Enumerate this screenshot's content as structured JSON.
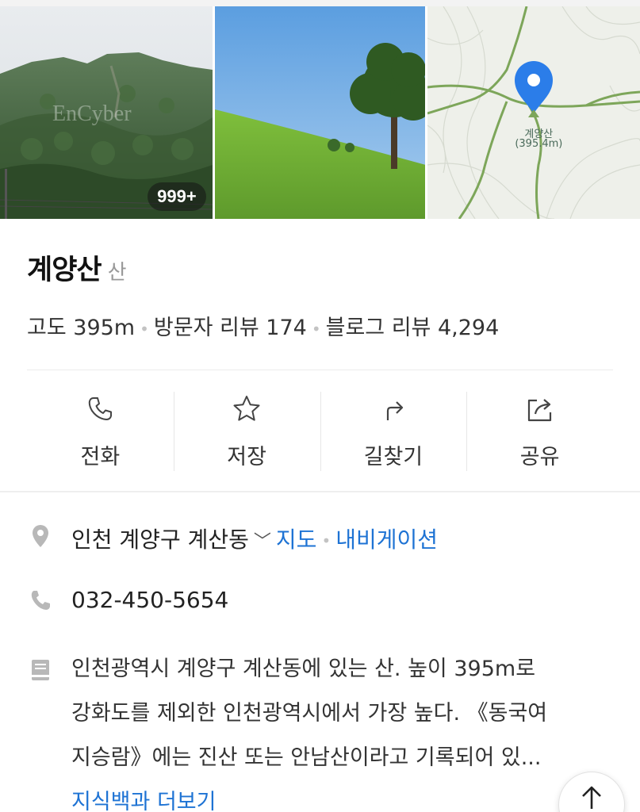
{
  "gallery": {
    "photo_count_badge": "999+",
    "watermark": "EnCyber",
    "map": {
      "peak_name": "계양산",
      "peak_elevation": "(395.4m)"
    }
  },
  "place": {
    "name": "계양산",
    "category": "산"
  },
  "stats": {
    "elevation": "고도 395m",
    "visitor_reviews": "방문자 리뷰 174",
    "blog_reviews": "블로그 리뷰 4,294"
  },
  "actions": [
    {
      "label": "전화",
      "icon": "phone-icon"
    },
    {
      "label": "저장",
      "icon": "star-icon"
    },
    {
      "label": "길찾기",
      "icon": "directions-icon"
    },
    {
      "label": "공유",
      "icon": "share-icon"
    }
  ],
  "info": {
    "address": "인천 계양구 계산동",
    "map_link": "지도",
    "navigation_link": "내비게이션",
    "phone": "032-450-5654",
    "description_lines": [
      "인천광역시 계양구 계산동에 있는 산. 높이 395m로",
      "강화도를 제외한 인천광역시에서 가장 높다. 《동국여",
      "지승람》에는 진산 또는 안남산이라고 기록되어 있..."
    ],
    "more_link": "지식백과 더보기"
  },
  "colors": {
    "link": "#1e73d4",
    "pin": "#2b7de9",
    "trail": "#7da65a"
  }
}
